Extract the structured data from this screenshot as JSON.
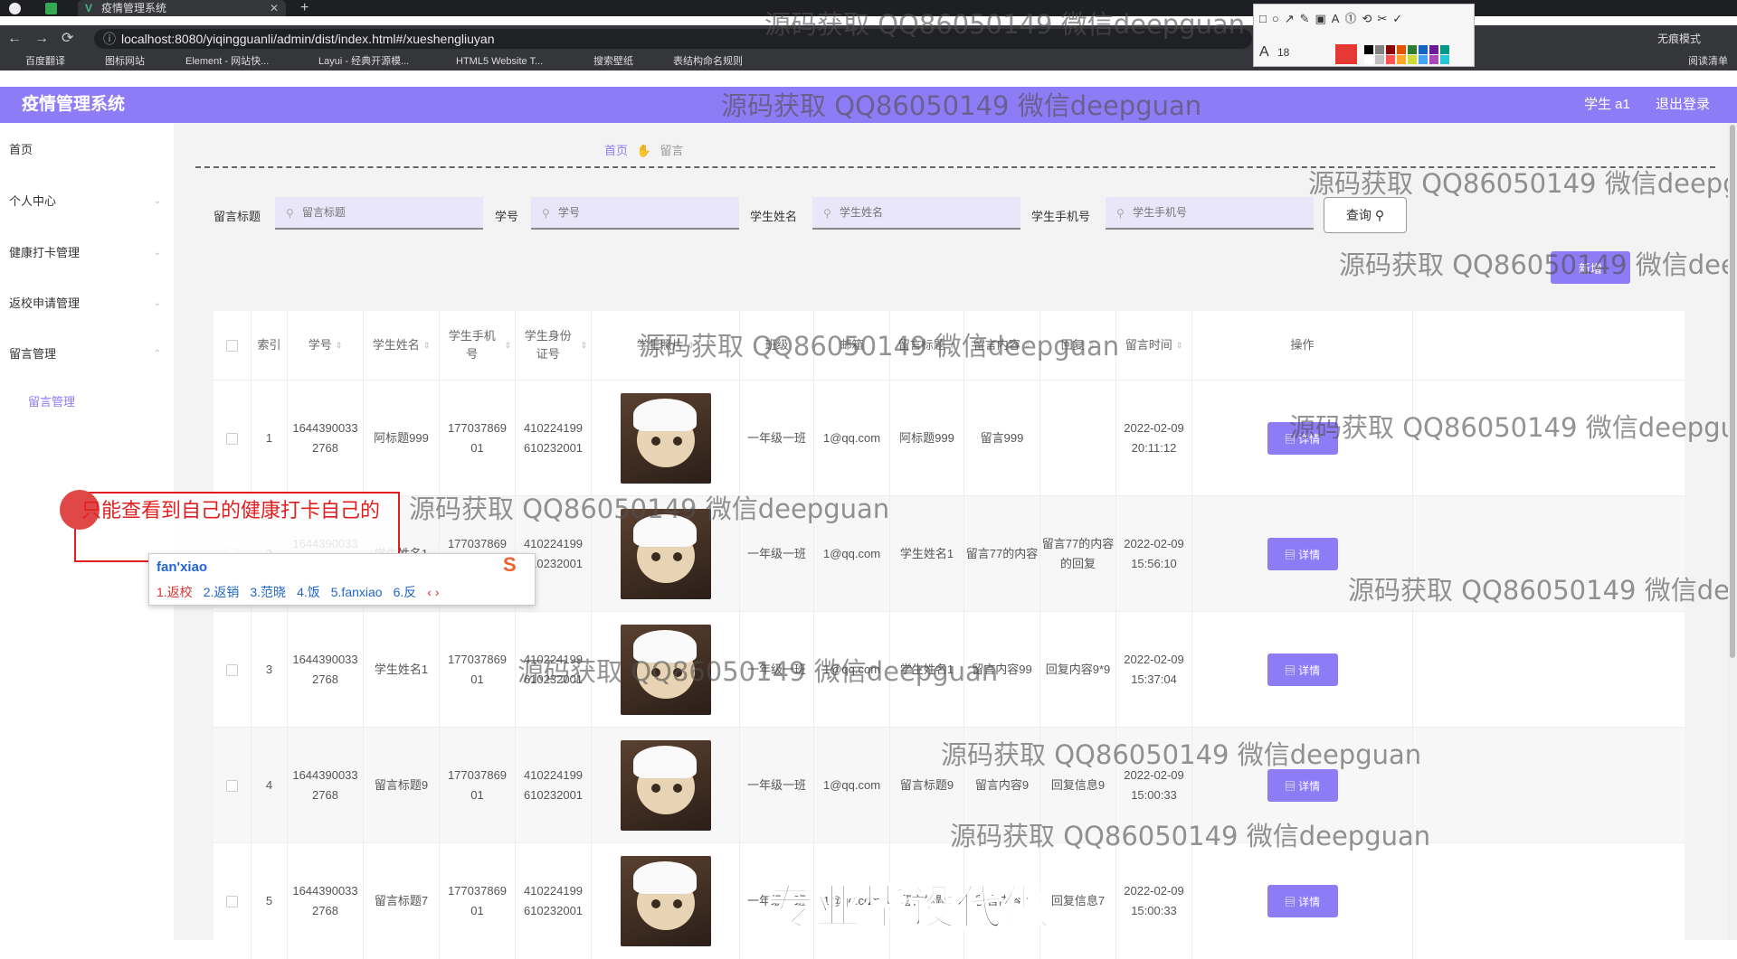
{
  "browser": {
    "tab_title": "疫情管理系统",
    "tab_close": "✕",
    "new_tab": "+",
    "back": "←",
    "forward": "→",
    "reload": "⟳",
    "url": "localhost:8080/yiqingguanli/admin/dist/index.html#/xueshengliuyan",
    "incognito": "无痕模式",
    "bookmarks": [
      "百度翻译",
      "图标网站",
      "Element - 网站快...",
      "Layui - 经典开源模...",
      "HTML5 Website T...",
      "搜索壁纸",
      "表结构命名规则"
    ],
    "reading_list": "阅读清单"
  },
  "drawtool": {
    "font_size": "18",
    "colors": [
      "#e53935",
      "#000000",
      "#808080",
      "#8b0000",
      "#e65100",
      "#2e7d32",
      "#1565c0",
      "#6a1b9a",
      "#009688",
      "#ffffff",
      "#c0c0c0",
      "#ff5252",
      "#ffa726",
      "#cddc39",
      "#42a5f5",
      "#ab47bc",
      "#26c6da"
    ]
  },
  "header": {
    "title": "疫情管理系统",
    "user": "学生 a1",
    "logout": "退出登录"
  },
  "sidebar": {
    "items": [
      {
        "label": "首页",
        "chevron": ""
      },
      {
        "label": "个人中心",
        "chevron": "⌄"
      },
      {
        "label": "健康打卡管理",
        "chevron": "⌄"
      },
      {
        "label": "返校申请管理",
        "chevron": "⌄"
      },
      {
        "label": "留言管理",
        "chevron": "⌃"
      }
    ],
    "sub_active": "留言管理"
  },
  "breadcrumb": {
    "home": "首页",
    "current": "留言"
  },
  "query": {
    "fields": [
      {
        "label": "留言标题",
        "placeholder": "留言标题"
      },
      {
        "label": "学号",
        "placeholder": "学号"
      },
      {
        "label": "学生姓名",
        "placeholder": "学生姓名"
      },
      {
        "label": "学生手机号",
        "placeholder": "学生手机号"
      }
    ],
    "search_btn": "查询",
    "add_btn": "新增"
  },
  "table": {
    "headers": [
      "索引",
      "学号",
      "学生姓名",
      "学生手机号",
      "学生身份证号",
      "学生照片",
      "班级",
      "邮箱",
      "留言标题",
      "留言内容",
      "回复",
      "留言时间",
      "操作"
    ],
    "detail_label": "详情",
    "rows": [
      {
        "idx": "1",
        "xh": "1644390033 2768",
        "name": "阿标题999",
        "phone": "177037869 01",
        "id": "410224199 610232001",
        "cls": "一年级一班",
        "email": "1@qq.com",
        "title": "阿标题999",
        "content": "留言999",
        "reply": "",
        "time": "2022-02-09 20:11:12"
      },
      {
        "idx": "2",
        "xh": "1644390033 2768",
        "name": "学生姓名1",
        "phone": "177037869 01",
        "id": "410224199 610232001",
        "cls": "一年级一班",
        "email": "1@qq.com",
        "title": "学生姓名1",
        "content": "留言77的内容",
        "reply": "留言77的内容的回复",
        "time": "2022-02-09 15:56:10"
      },
      {
        "idx": "3",
        "xh": "1644390033 2768",
        "name": "学生姓名1",
        "phone": "177037869 01",
        "id": "410224199 610232001",
        "cls": "一年级一班",
        "email": "1@qq.com",
        "title": "学生姓名1",
        "content": "留言内容99",
        "reply": "回复内容9*9",
        "time": "2022-02-09 15:37:04"
      },
      {
        "idx": "4",
        "xh": "1644390033 2768",
        "name": "留言标题9",
        "phone": "177037869 01",
        "id": "410224199 610232001",
        "cls": "一年级一班",
        "email": "1@qq.com",
        "title": "留言标题9",
        "content": "留言内容9",
        "reply": "回复信息9",
        "time": "2022-02-09 15:00:33"
      },
      {
        "idx": "5",
        "xh": "1644390033 2768",
        "name": "留言标题7",
        "phone": "177037869 01",
        "id": "410224199 610232001",
        "cls": "一年级一班",
        "email": "1@qq.com",
        "title": "留言标题7",
        "content": "留言内容7",
        "reply": "回复信息7",
        "time": "2022-02-09 15:00:33"
      }
    ]
  },
  "overlay": {
    "annotation": "只能查看到自己的健康打卡自己的",
    "ime_input": "fan'xiao",
    "ime_candidates": [
      "1.返校",
      "2.返销",
      "3.范晓",
      "4.饭",
      "5.fanxiao",
      "6.反"
    ],
    "ime_logo": "S"
  },
  "watermark": "源码获取 QQ86050149 微信deepguan",
  "promo": "专业毕设代做",
  "colors": {
    "accent": "#8e7cf7",
    "annotation": "#e02020"
  }
}
